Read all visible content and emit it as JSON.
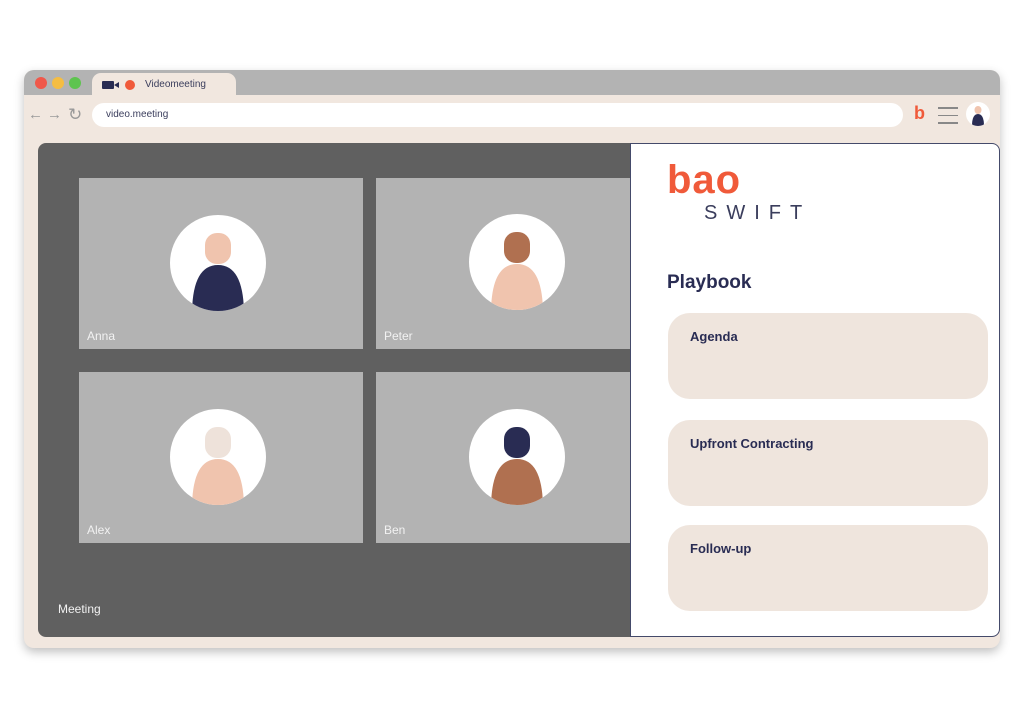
{
  "browser": {
    "tab_title": "Videomeeting",
    "tab_icons": [
      "video-camera-icon",
      "record-icon"
    ],
    "url": "video.meeting",
    "nav_icons": [
      "back-arrow-icon",
      "forward-arrow-icon",
      "reload-icon"
    ],
    "toolbar_icons": [
      "bao-extension-icon",
      "hamburger-menu-icon",
      "user-avatar-icon"
    ],
    "traffic_lights": [
      "#f0584a",
      "#f5bd42",
      "#5ec44f"
    ]
  },
  "meeting": {
    "label": "Meeting",
    "participants": [
      {
        "name": "Anna",
        "head": "#f0c4ae",
        "body": "#292c53"
      },
      {
        "name": "Peter",
        "head": "#b07050",
        "body": "#f0c4ae"
      },
      {
        "name": "Alex",
        "head": "#eee2da",
        "body": "#f0c4ae"
      },
      {
        "name": "Ben",
        "head": "#292c53",
        "body": "#b07050"
      }
    ]
  },
  "panel": {
    "logo": "bao",
    "product": "SWIFT",
    "heading": "Playbook",
    "cards": [
      "Agenda",
      "Upfront Contracting",
      "Follow-up"
    ]
  },
  "colors": {
    "accent": "#f05a3a",
    "navy": "#292c53",
    "beige": "#f1e7df"
  }
}
